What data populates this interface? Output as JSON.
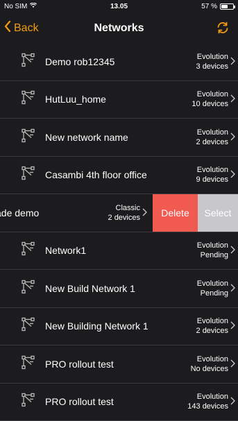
{
  "status_bar": {
    "carrier": "No SIM",
    "time": "13.05",
    "battery": "57 %",
    "battery_level": 0.57
  },
  "nav": {
    "back_label": "Back",
    "title": "Networks",
    "accent_color": "#f39c12"
  },
  "networks": [
    {
      "name": "Demo rob12345",
      "type": "Evolution",
      "status": "3 devices"
    },
    {
      "name": "HutLuu_home",
      "type": "Evolution",
      "status": "10 devices"
    },
    {
      "name": "New network name",
      "type": "Evolution",
      "status": "2 devices"
    },
    {
      "name": "Casambi 4th floor office",
      "type": "Evolution",
      "status": "9 devices"
    },
    {
      "name": "ade demo",
      "type": "Classic",
      "status": "2 devices",
      "swiped": true
    },
    {
      "name": "Network1",
      "type": "Evolution",
      "status": "Pending"
    },
    {
      "name": "New Build Network 1",
      "type": "Evolution",
      "status": "Pending"
    },
    {
      "name": "New Building Network 1",
      "type": "Evolution",
      "status": "2 devices"
    },
    {
      "name": "PRO rollout test",
      "type": "Evolution",
      "status": "No devices"
    },
    {
      "name": "PRO rollout test",
      "type": "Evolution",
      "status": "143 devices"
    }
  ],
  "swipe_actions": {
    "delete_label": "Delete",
    "select_label": "Select"
  },
  "icons": {
    "network": "network-node-icon",
    "chevron": "chevron-right-icon",
    "refresh": "refresh-icon",
    "back": "chevron-left-icon"
  }
}
